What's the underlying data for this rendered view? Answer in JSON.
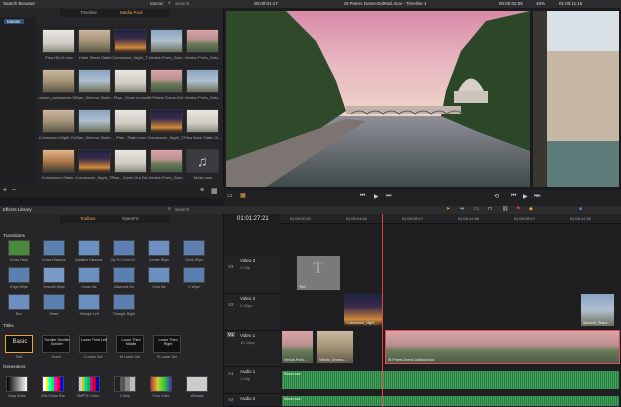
{
  "media_browser": {
    "title": "Search Browser",
    "tabs": [
      "Timeline",
      "Media Pool"
    ],
    "search_placeholder": "Search",
    "dropdown": "Master",
    "bin_label": "Master",
    "clips": [
      {
        "name": "Pisa-HD-H.mov",
        "style": "grad5"
      },
      {
        "name": "Hotel Street Static",
        "style": "grad2"
      },
      {
        "name": "Colosseum_Night_T...",
        "style": "grad6"
      },
      {
        "name": "Venice-Porto_Salu...",
        "style": "grad3"
      },
      {
        "name": "Venice-Porto_Salu...",
        "style": "grad1"
      },
      {
        "name": "roman_colosseum-St...",
        "style": "grad2"
      },
      {
        "name": "San_Simeon-Static...",
        "style": "grad3"
      },
      {
        "name": "Pisa - Zoom in.mov",
        "style": "grad5"
      },
      {
        "name": "St Peters Dome-Dol...",
        "style": "grad1"
      },
      {
        "name": "Venice-Porto_Salu...",
        "style": "grad3"
      },
      {
        "name": "Colosseum-Night-Gri...",
        "style": "grad2"
      },
      {
        "name": "San_Simeon-Static...",
        "style": "grad3"
      },
      {
        "name": "Pisa - Static.mov",
        "style": "grad5"
      },
      {
        "name": "Colosseum_Night_T...",
        "style": "grad6"
      },
      {
        "name": "Pisa Back Static Gr...",
        "style": "grad5"
      },
      {
        "name": "Colosseum-Static...",
        "style": "grad4"
      },
      {
        "name": "Colosseum_Night_T...",
        "style": "grad6"
      },
      {
        "name": "Pisa - Zoom Out-Da...",
        "style": "grad5"
      },
      {
        "name": "Venice-Porto_Salu...",
        "style": "grad1"
      },
      {
        "name": "Music.wav",
        "style": "music"
      }
    ]
  },
  "viewer": {
    "timecode_left": "00:00:01:17",
    "title": "St Peters Dome-DolMoil.mov - Timeline 1",
    "timecode_right": "00:00:02:08",
    "zoom": "48%",
    "timecode_far": "01:00:11:15"
  },
  "effects": {
    "title": "Effects Library",
    "search": "Search",
    "tabs": [
      "Toolbox",
      "OpenFX"
    ],
    "transitions_heading": "Transitions",
    "transitions": [
      "Cross Fade",
      "Cross Dissolve",
      "Additive Dissolve",
      "Dip To Color Di...",
      "Center Wipe",
      "Clock Wipe",
      "Edge Wipe",
      "Smooth Wipe",
      "Cross Iris",
      "Diamond Iris",
      "Oval Iris",
      "X Wipe",
      "Box",
      "Heart",
      "Triangle Left",
      "Triangle Right"
    ],
    "titles_heading": "Titles",
    "titles": [
      {
        "big": "Basic",
        "small": "Text"
      },
      {
        "big": "Scroller Scroller Scroller",
        "small": "Scroll"
      },
      {
        "big": "Lower Third Left",
        "small": "L Lower 3rd"
      },
      {
        "big": "Lower Third Middle",
        "small": "M Lower 3rd"
      },
      {
        "big": "Lower Third Right",
        "small": "R Lower 3rd"
      }
    ],
    "generators_heading": "Generators",
    "generators": [
      "Gray Scale",
      "EBU Color Bar",
      "SMPTE Color...",
      "4 Step",
      "Four Color",
      "Window"
    ]
  },
  "timeline": {
    "timecode": "01:01:27:21",
    "ruler": [
      "01:00:00:02",
      "01:00:04:02",
      "01:00:08:17",
      "01:00:12:06",
      "01:00:08:17",
      "01:00:12:02"
    ],
    "tracks": [
      {
        "id": "V3",
        "name": "Video 3",
        "sub": "1 Clip"
      },
      {
        "id": "V2",
        "name": "Video 2",
        "sub": "3 Clips"
      },
      {
        "id": "V1",
        "name": "Video 1",
        "sub": "10 Clips"
      },
      {
        "id": "A1",
        "name": "Audio 1",
        "sub": "1 Clip"
      },
      {
        "id": "A2",
        "name": "Audio 2",
        "sub": ""
      }
    ],
    "clips": {
      "text": "Text",
      "colosseum": "Colosseum_Night_...",
      "spanish": "Spanish_Steps...",
      "venice": "Venice-Porti...",
      "vittorio": "Vittorio_Emanu...",
      "stpeters": "St Peters Dome-DolMoil.mov",
      "music1": "Music.wav",
      "music2": "Music.wav"
    }
  }
}
